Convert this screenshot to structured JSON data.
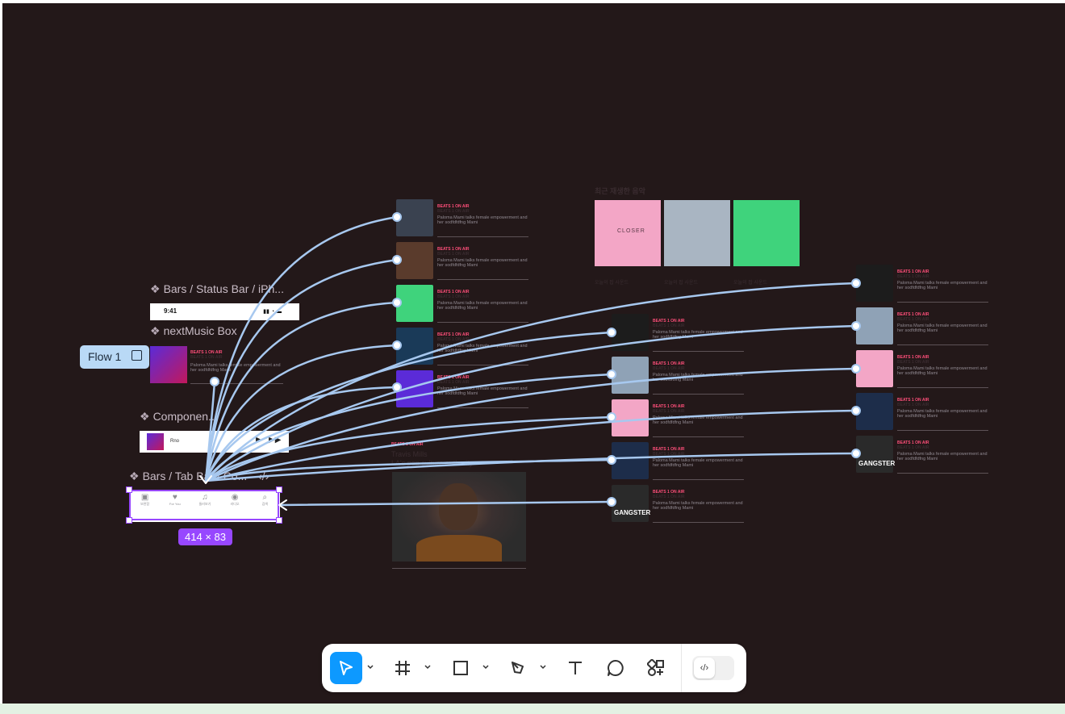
{
  "frames": {
    "status_bar": "Bars / Status Bar / iPh...",
    "next_music_box": "nextMusic Box",
    "component": "Componen...",
    "tab_bar": "Bars / Tab Bar / Co...",
    "status_time": "9:41"
  },
  "flow_label": "Flow 1",
  "dimension_badge": "414 × 83",
  "next_music": {
    "title": "BEATS 1 ON AIR",
    "subtitle": "BEATS 1 ON AIR",
    "desc": "Paloma Mami talks female empowerment and her sodfdfdfng Mami"
  },
  "mini_player": {
    "track": "Rno"
  },
  "tab_items": [
    "보관함",
    "For You",
    "둘러보기",
    "라디오",
    "검색"
  ],
  "col1_cards": [
    {
      "title": "BEATS 1 ON AIR",
      "subtitle": "BEATS 1 ON AIR",
      "desc": "Paloma Mami talks female empowerment and her sodfdfdfng Mami",
      "art": "#3a4250"
    },
    {
      "title": "BEATS 1 ON AIR",
      "subtitle": "BEATS 1 ON AIR",
      "desc": "Paloma Mami talks female empowerment and her sodfdfdfng Mami",
      "art": "#5a3b2c"
    },
    {
      "title": "BEATS 1 ON AIR",
      "subtitle": "BEATS 1 ON AIR",
      "desc": "Paloma Mami talks female empowerment and her sodfdfdfng Mami",
      "art": "#3fd37c"
    },
    {
      "title": "BEATS 1 ON AIR",
      "subtitle": "BEATS 1 ON AIR",
      "desc": "Paloma Mami talks female empowerment and her sodfdfdfng Mami",
      "art": "#1a3a58"
    },
    {
      "title": "BEATS 1 ON AIR",
      "subtitle": "BEATS 1 ON AIR",
      "desc": "Paloma Mami talks female empowerment and her sodfdfdfng Mami",
      "art": "#5b2bd8"
    }
  ],
  "feature": {
    "title": "BEATS 1 ON AIR",
    "name": "Travis Mills",
    "tagline": "LA's pop culture authority"
  },
  "recent": {
    "heading": "최근 재생한 음악",
    "items": [
      {
        "caption": "오늘의 팝 사운드",
        "art": "#f3a6c6",
        "art_text": "CLOSER"
      },
      {
        "caption": "오늘의 팝 사운드",
        "art": "#a9b5c2",
        "art_text": ""
      },
      {
        "caption": "오늘의 팝 사운드",
        "art": "#3fd37c",
        "art_text": ""
      }
    ]
  },
  "col3_cards": [
    {
      "title": "BEATS 1 ON AIR",
      "subtitle": "BEATS 1 ON AIR",
      "desc": "Paloma Mami talks female empowerment and her sodfdfdfng Mami",
      "art": "#1c1c1c"
    },
    {
      "title": "BEATS 1 ON AIR",
      "subtitle": "BEATS 1 ON AIR",
      "desc": "Paloma Mami talks female empowerment and her sodfdfdfng Mami",
      "art": "#8fa2b6"
    },
    {
      "title": "BEATS 1 ON AIR",
      "subtitle": "BEATS 1 ON AIR",
      "desc": "Paloma Mami talks female empowerment and her sodfdfdfng Mami",
      "art": "#f3a6c6"
    },
    {
      "title": "BEATS 1 ON AIR",
      "subtitle": "BEATS 1 ON AIR",
      "desc": "Paloma Mami talks female empowerment and her sodfdfdfng Mami",
      "art": "#1d2d4a"
    },
    {
      "title": "BEATS 1 ON AIR",
      "subtitle": "BEATS 1 ON AIR",
      "desc": "Paloma Mami talks female empowerment and her sodfdfdfng Mami",
      "art": "#2a2a2a",
      "art_text": "GANGSTER"
    }
  ],
  "col4_cards": [
    {
      "title": "BEATS 1 ON AIR",
      "subtitle": "BEATS 1 ON AIR",
      "desc": "Paloma Mami talks female empowerment and her sodfdfdfng Mami",
      "art": "#1c1c1c"
    },
    {
      "title": "BEATS 1 ON AIR",
      "subtitle": "BEATS 1 ON AIR",
      "desc": "Paloma Mami talks female empowerment and her sodfdfdfng Mami",
      "art": "#8fa2b6"
    },
    {
      "title": "BEATS 1 ON AIR",
      "subtitle": "BEATS 1 ON AIR",
      "desc": "Paloma Mami talks female empowerment and her sodfdfdfng Mami",
      "art": "#f3a6c6"
    },
    {
      "title": "BEATS 1 ON AIR",
      "subtitle": "BEATS 1 ON AIR",
      "desc": "Paloma Mami talks female empowerment and her sodfdfdfng Mami",
      "art": "#1d2d4a"
    },
    {
      "title": "BEATS 1 ON AIR",
      "subtitle": "BEATS 1 ON AIR",
      "desc": "Paloma Mami talks female empowerment and her sodfdfdfng Mami",
      "art": "#2a2a2a",
      "art_text": "GANGSTER"
    }
  ],
  "toolbar": {
    "tools": [
      "move-tool",
      "frame-tool",
      "shape-tool",
      "pen-tool",
      "text-tool",
      "comment-tool",
      "actions-tool",
      "dev-mode-toggle"
    ],
    "active": "move-tool",
    "accent": "#0d99ff"
  },
  "colors": {
    "canvas": "#231819",
    "connector": "#a7c8ef",
    "selection": "#9747ff",
    "highlight": "#ff4f7a"
  }
}
